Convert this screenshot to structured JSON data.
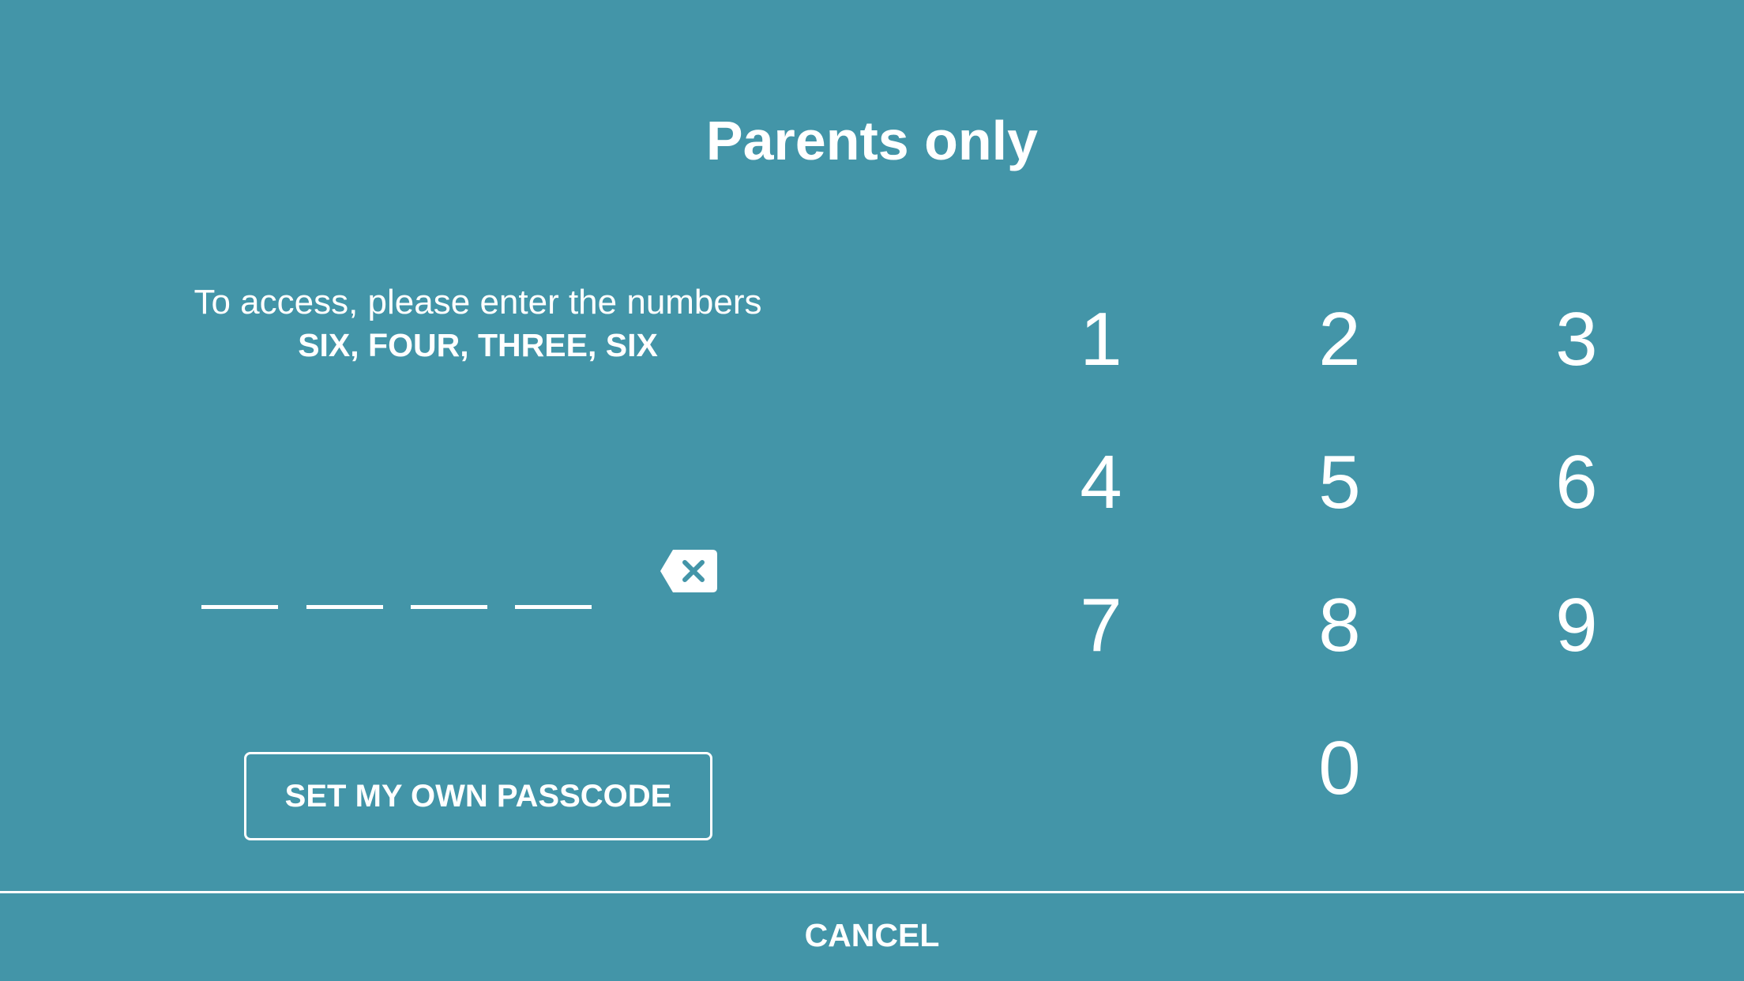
{
  "title": "Parents only",
  "instructions": {
    "line1": "To access, please enter the numbers",
    "line2": "SIX, FOUR, THREE, SIX"
  },
  "passcode_entry": {
    "slot_count": 4,
    "entered_digits": "",
    "backspace_icon": "backspace-x-icon"
  },
  "keypad": {
    "keys": [
      "1",
      "2",
      "3",
      "4",
      "5",
      "6",
      "7",
      "8",
      "9",
      "0"
    ]
  },
  "buttons": {
    "set_passcode_label": "SET MY OWN PASSCODE",
    "cancel_label": "CANCEL"
  },
  "colors": {
    "background": "#4395a8",
    "foreground": "#ffffff"
  }
}
